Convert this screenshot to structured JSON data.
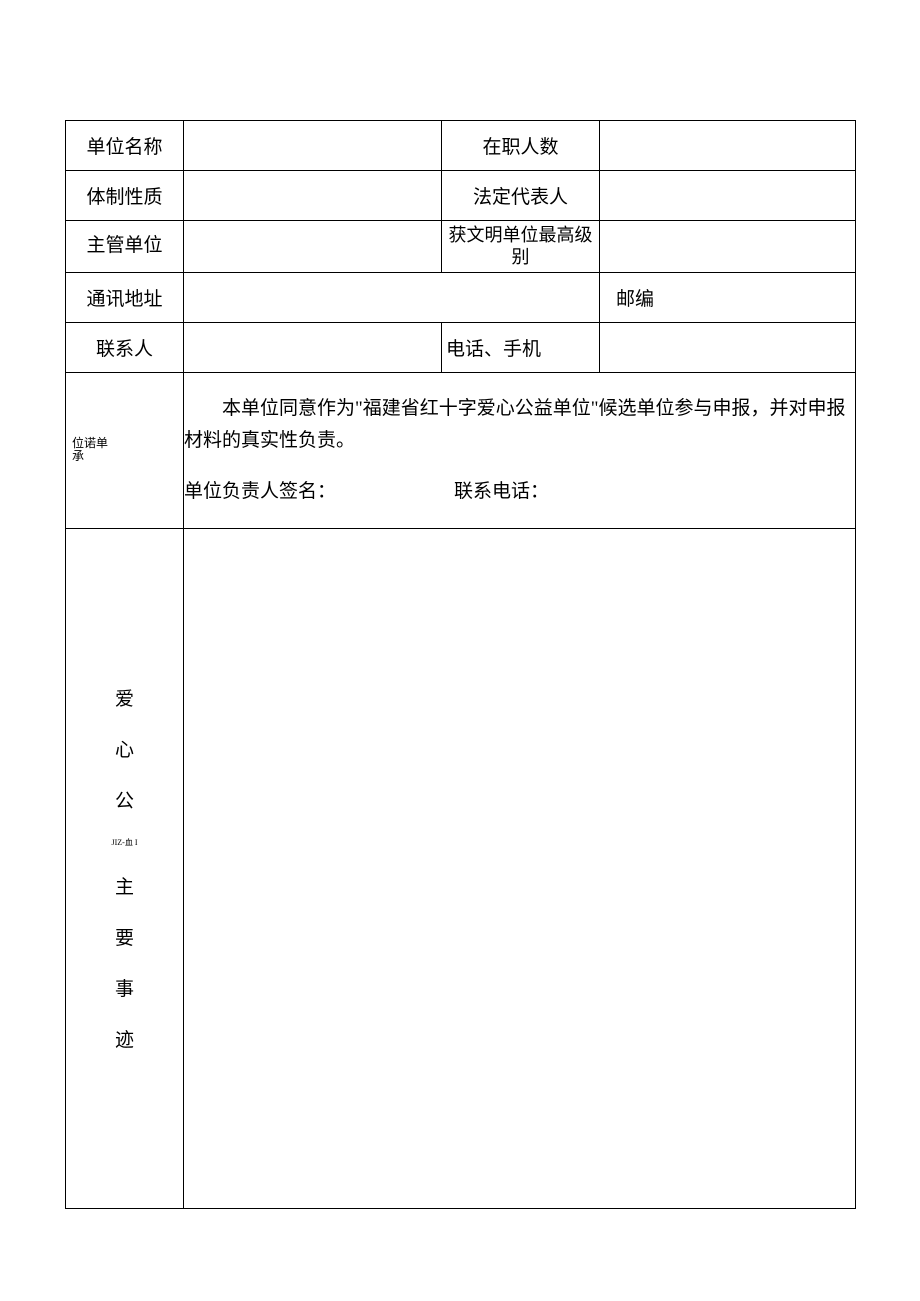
{
  "rows": {
    "r1c1": "单位名称",
    "r1c3": "在职人数",
    "r2c1": "体制性质",
    "r2c3": "法定代表人",
    "r3c1": "主管单位",
    "r3c3": "获文明单位最高级别",
    "r4c1": "通讯地址",
    "r4c3": "邮编",
    "r5c1": "联系人",
    "r5c3": "电话、手机"
  },
  "commitment": {
    "label_line1": "位诺单",
    "label_line2": "承",
    "text": "本单位同意作为\"福建省红十字爱心公益单位\"候选单位参与申报，并对申报材料的真实性负责。",
    "sig1": "单位负责人签名：",
    "sig2": "联系电话："
  },
  "deeds": {
    "c1": "爱",
    "c2": "心",
    "c3": "公",
    "small": "JIZ-血 I",
    "c4": "主",
    "c5": "要",
    "c6": "事",
    "c7": "迹"
  }
}
